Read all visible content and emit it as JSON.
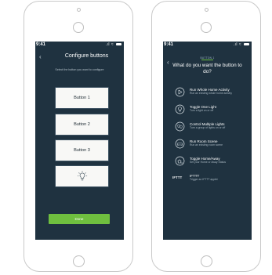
{
  "status": {
    "time": "9:41"
  },
  "screen1": {
    "title": "Configure buttons",
    "subtitle": "Select the button you want to configure",
    "buttons": [
      "Button 1",
      "Button 2",
      "Button 3"
    ],
    "done_label": "Done"
  },
  "screen2": {
    "eyebrow": "BUTTON 1",
    "title": "What do you want the button to do?",
    "options": [
      {
        "icon": "play-icon",
        "title": "Run Whole Home Activity",
        "desc": "Run an existing whole home activity"
      },
      {
        "icon": "lightbulb-icon",
        "title": "Toggle One Light",
        "desc": "Turn a light on or off"
      },
      {
        "icon": "multiple-lights-icon",
        "title": "Control Multiple Lights",
        "desc": "Turn a group of lights on or off"
      },
      {
        "icon": "room-scene-icon",
        "title": "Run Room Scene",
        "desc": "Run an existing room scene"
      },
      {
        "icon": "home-away-icon",
        "title": "Toggle Home/Away",
        "desc": "Set your Home or Away Status"
      },
      {
        "icon": "ifttt-logo",
        "title": "IFTTT",
        "desc": "Trigger an IFTTT applet",
        "logo_text": "IFTTT"
      }
    ]
  },
  "colors": {
    "screen_bg": "#1f3240",
    "accent_green": "#6fbf3f",
    "tile_bg": "#f8f8f6"
  }
}
